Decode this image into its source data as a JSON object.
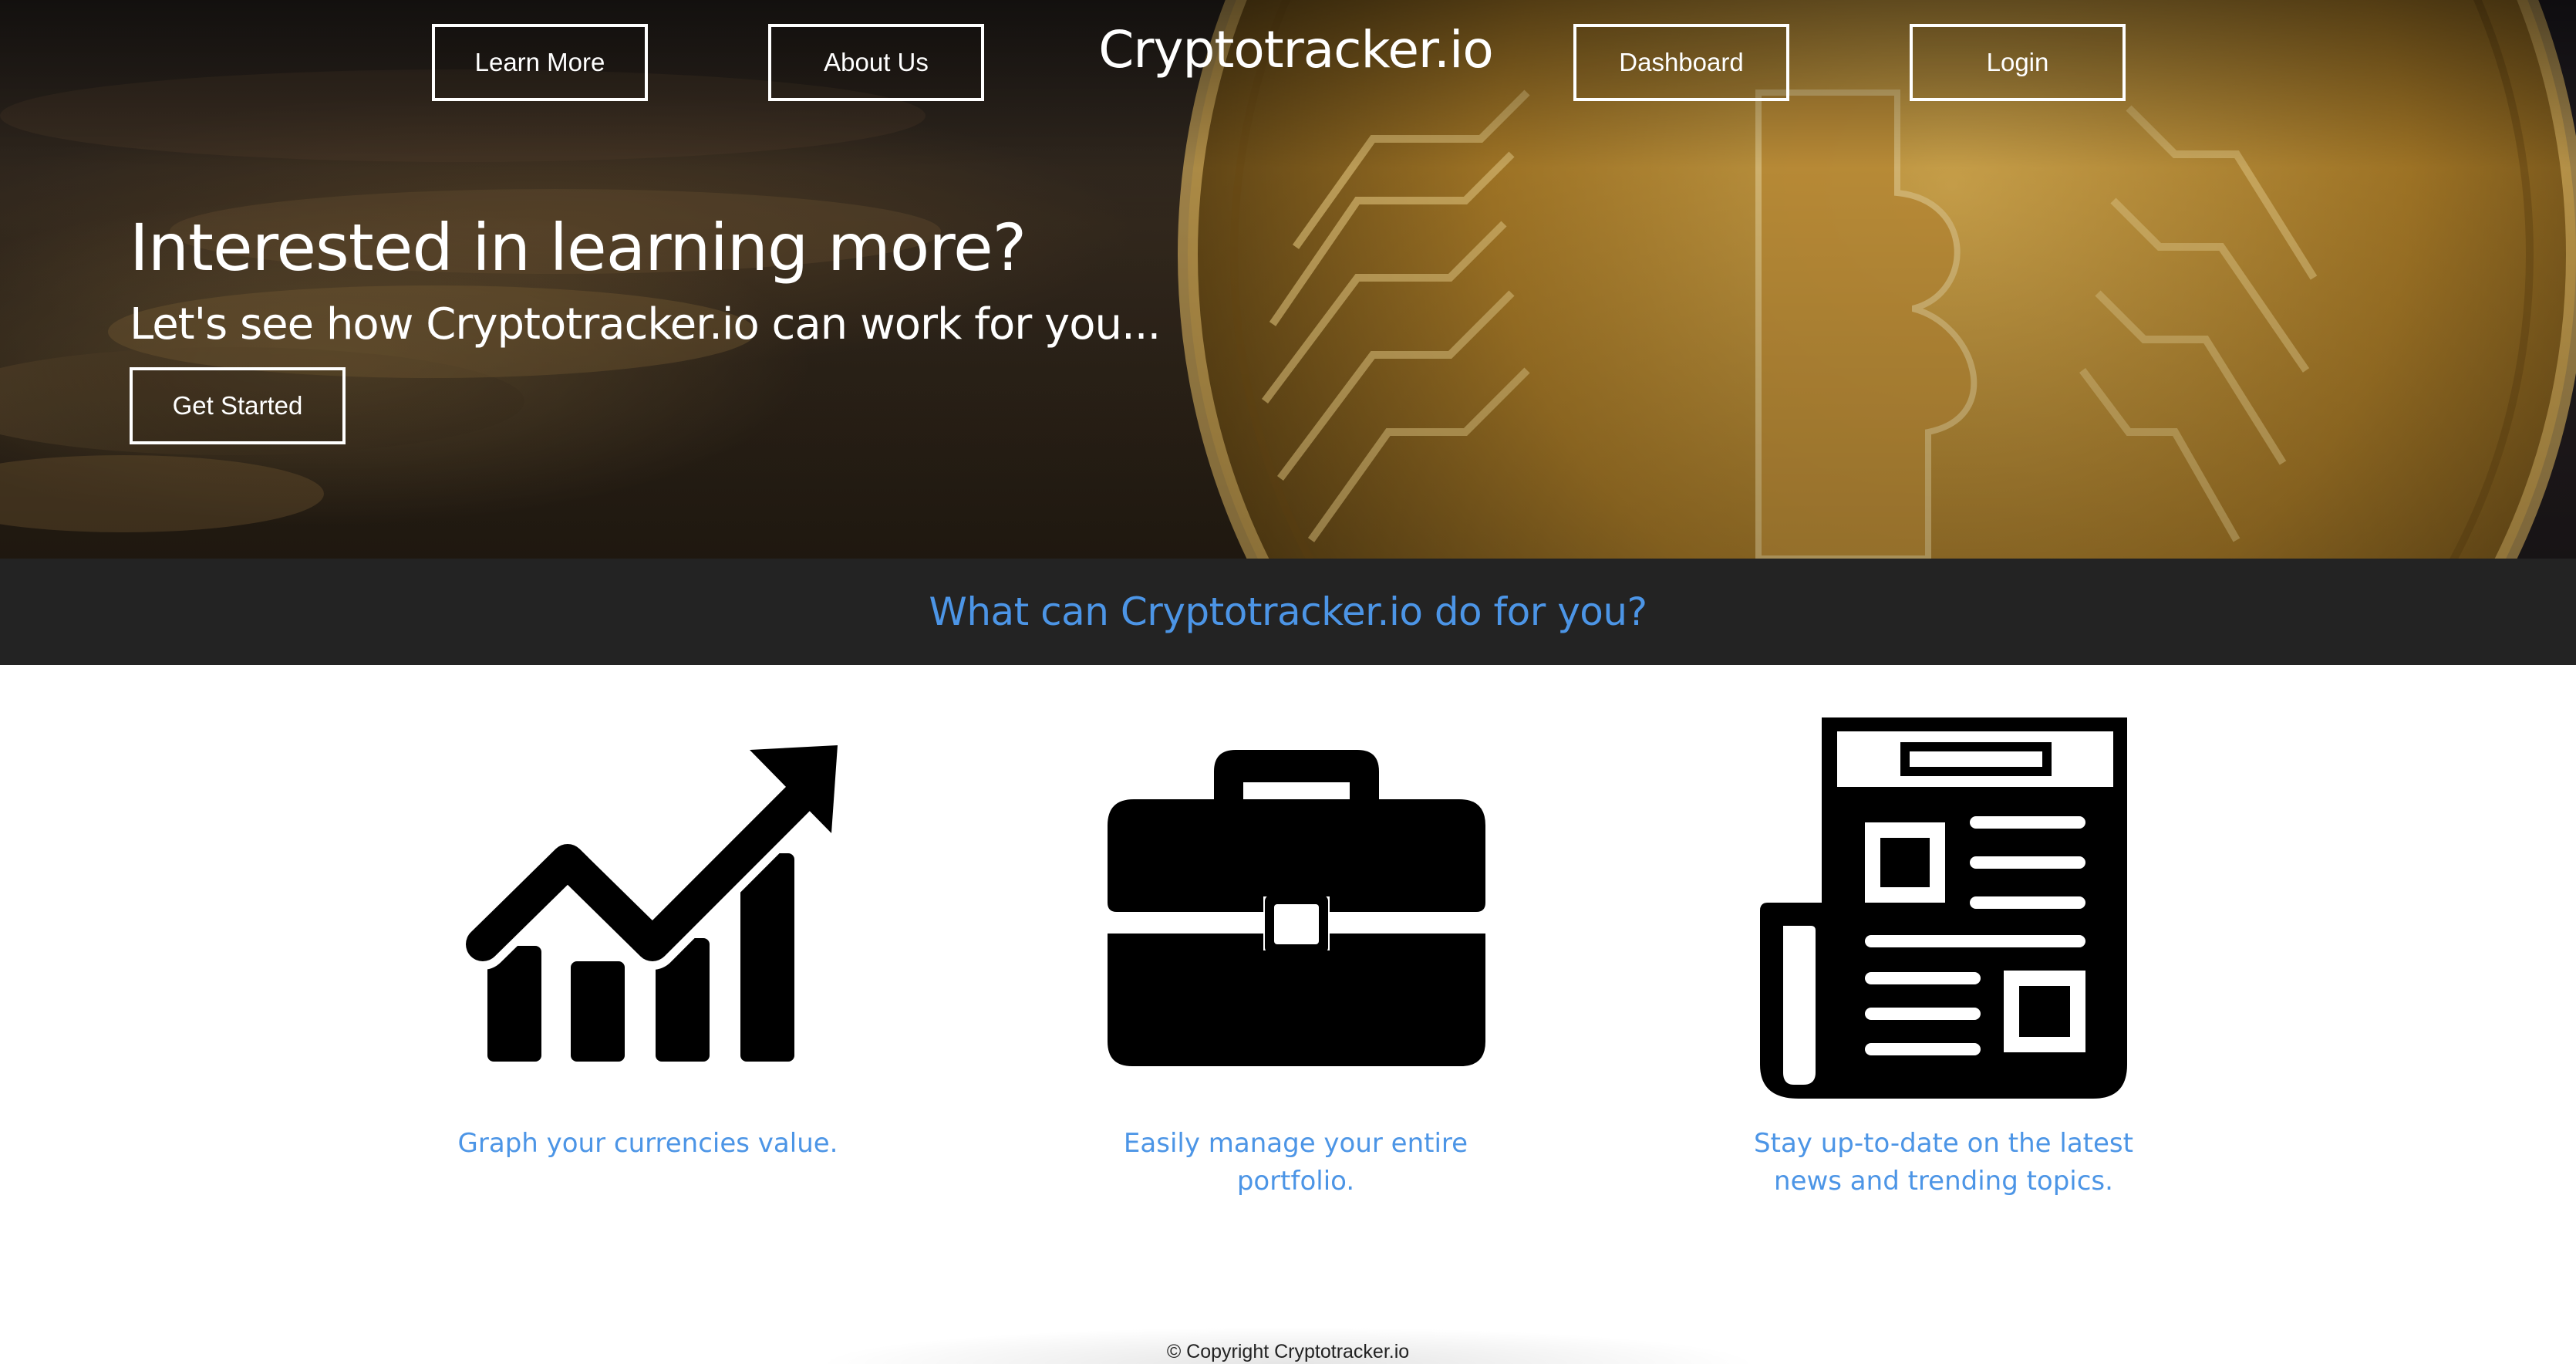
{
  "nav": {
    "learn_more": "Learn More",
    "about_us": "About Us",
    "brand": "Cryptotracker.io",
    "dashboard": "Dashboard",
    "login": "Login"
  },
  "hero": {
    "title": "Interested in learning more?",
    "subtitle": "Let's see how Cryptotracker.io can work for you...",
    "cta": "Get Started",
    "background": "bitcoin-coin-image"
  },
  "section": {
    "heading": "What can Cryptotracker.io do for you?"
  },
  "features": [
    {
      "icon": "growth-chart-icon",
      "caption": "Graph your currencies value."
    },
    {
      "icon": "briefcase-icon",
      "caption": "Easily manage your entire portfolio."
    },
    {
      "icon": "newspaper-icon",
      "caption": "Stay up-to-date on the latest news and trending topics."
    }
  ],
  "footer": {
    "copyright": "© Copyright Cryptotracker.io"
  },
  "colors": {
    "accent": "#4c95e6",
    "band": "#232323",
    "gold": "#c99a2e"
  }
}
